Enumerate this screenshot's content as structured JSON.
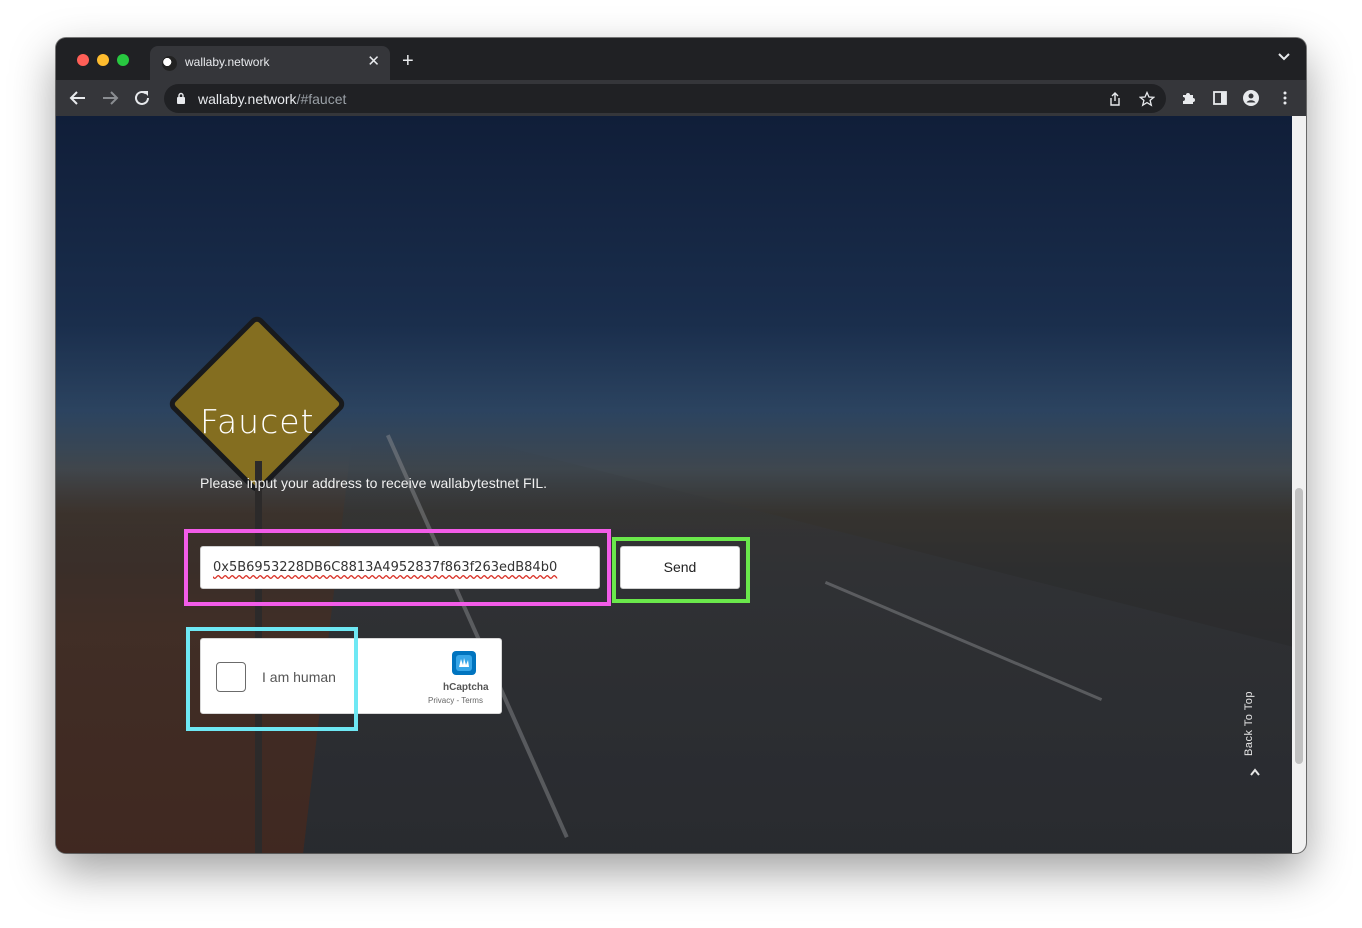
{
  "browser": {
    "tab_title": "wallaby.network",
    "tab_close_glyph": "✕",
    "new_tab_glyph": "+",
    "url_host": "wallaby.network",
    "url_path": "/#faucet",
    "icons": [
      "back-icon",
      "forward-icon",
      "reload-icon",
      "lock-icon",
      "share-icon",
      "star-icon",
      "extensions-icon",
      "side-panel-icon",
      "profile-icon",
      "menu-icon",
      "tab-search-chevron-icon"
    ]
  },
  "page": {
    "title": "Faucet",
    "description": "Please input your address to receive wallabytestnet FIL.",
    "address_value": "0x5B6953228DB6C8813A4952837f863f263edB84b0",
    "send_label": "Send",
    "captcha": {
      "label": "I am human",
      "brand": "hCaptcha",
      "links": "Privacy - Terms"
    },
    "back_to_top": "Back To Top"
  },
  "colors": {
    "highlight_input": "#f25ce8",
    "highlight_send": "#6ae84b",
    "highlight_captcha": "#6ee8f4"
  }
}
